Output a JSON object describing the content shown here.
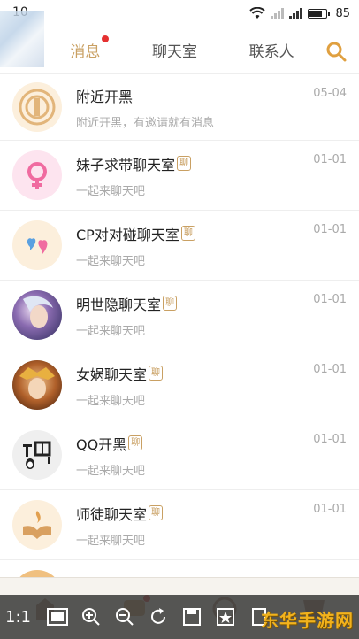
{
  "status": {
    "time": "10",
    "battery": "85"
  },
  "tabs": [
    {
      "label": "消息",
      "active": true,
      "has_dot": true
    },
    {
      "label": "聊天室",
      "active": false
    },
    {
      "label": "联系人",
      "active": false
    }
  ],
  "conversations": [
    {
      "title": "附近开黑",
      "subtitle": "附近开黑，有邀请就有消息",
      "date": "05-04",
      "badge": "",
      "avatar": "compass-emblem-icon"
    },
    {
      "title": "妹子求带聊天室",
      "subtitle": "一起来聊天吧",
      "date": "01-01",
      "badge": "聊",
      "avatar": "female-symbol-icon"
    },
    {
      "title": "CP对对碰聊天室",
      "subtitle": "一起来聊天吧",
      "date": "01-01",
      "badge": "聊",
      "avatar": "hearts-icon"
    },
    {
      "title": "明世隐聊天室",
      "subtitle": "一起来聊天吧",
      "date": "01-01",
      "badge": "聊",
      "avatar": "hero-portrait"
    },
    {
      "title": "女娲聊天室",
      "subtitle": "一起来聊天吧",
      "date": "01-01",
      "badge": "聊",
      "avatar": "hero-portrait"
    },
    {
      "title": "QQ开黑",
      "subtitle": "一起来聊天吧",
      "date": "01-01",
      "badge": "聊",
      "avatar": "qq-kaihei-logo"
    },
    {
      "title": "师徒聊天室",
      "subtitle": "一起来聊天吧",
      "date": "01-01",
      "badge": "聊",
      "avatar": "book-flame-icon"
    }
  ],
  "viewer": {
    "zoom_label": "1:1"
  },
  "watermark": "东华手游网",
  "colors": {
    "accent": "#c9a063",
    "badge_dot": "#e53030"
  }
}
